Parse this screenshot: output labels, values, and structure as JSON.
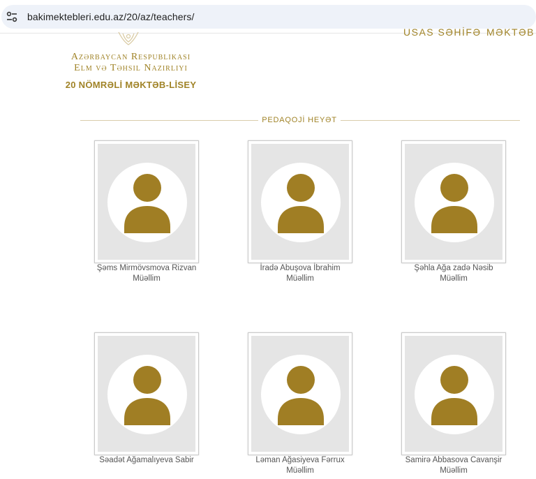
{
  "browser": {
    "url": "bakimektebleri.edu.az/20/az/teachers/",
    "site_settings_icon": "tune-icon"
  },
  "nav": {
    "items": [
      "USAS SƏHİFƏ",
      "MƏKTƏB"
    ]
  },
  "header": {
    "ministry_line1": "Azərbaycan Respublikası",
    "ministry_line2": "Elm və Təhsil Nazirliyi",
    "school_name": "20 NÖMRƏLİ MƏKTƏB-LİSEY"
  },
  "section": {
    "title": "PEDAQOJİ HEYƏT"
  },
  "colors": {
    "brand_gold": "#a08327",
    "avatar_gold": "#a07e24",
    "photo_bg": "#e5e5e5"
  },
  "teachers": [
    {
      "name": "Şəms Mirmövsmova Rizvan",
      "role": "Müəllim"
    },
    {
      "name": "İradə Abuşova İbrahim",
      "role": "Müəllim"
    },
    {
      "name": "Şəhla Ağa zadə Nəsib",
      "role": "Müəllim"
    },
    {
      "name": "Səadət Ağamalıyeva Sabir",
      "role": ""
    },
    {
      "name": "Ləman Ağasiyeva Fərrux",
      "role": "Müəllim"
    },
    {
      "name": "Samirə Abbasova Cavanşir",
      "role": "Müəllim"
    }
  ]
}
